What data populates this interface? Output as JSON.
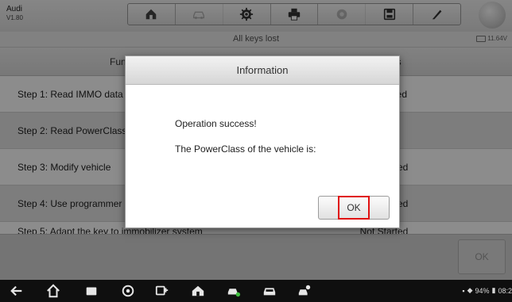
{
  "app": {
    "make": "Audi",
    "version": "V1.80"
  },
  "toolbar": {
    "buttons": [
      {
        "icon": "home-icon",
        "enabled": true
      },
      {
        "icon": "vehicle-swap-icon",
        "enabled": false
      },
      {
        "icon": "settings-icon",
        "enabled": true
      },
      {
        "icon": "print-icon",
        "enabled": true
      },
      {
        "icon": "help-icon",
        "enabled": false
      },
      {
        "icon": "save-icon",
        "enabled": true
      },
      {
        "icon": "data-logging-icon",
        "enabled": true
      }
    ]
  },
  "subtitle": "All keys lost",
  "voltage": "11.64V",
  "table": {
    "headers": [
      "Function",
      "Process"
    ],
    "rows": [
      {
        "function": "Step 1: Read IMMO data",
        "status": "Completed"
      },
      {
        "function": "Step 2: Read PowerClass",
        "status": ""
      },
      {
        "function": "Step 3: Modify vehicle",
        "status": "Not Started"
      },
      {
        "function": "Step 4: Use programmer",
        "status": "Not Started"
      },
      {
        "function": "Step 5: Adapt the key to immobilizer system",
        "status": "Not Started"
      }
    ]
  },
  "footer": {
    "ok_label": "OK"
  },
  "dialog": {
    "title": "Information",
    "line1": "Operation success!",
    "line2": "The PowerClass of the vehicle is:",
    "ok_label": "OK"
  },
  "navbar": {
    "icons": [
      "back-icon",
      "home-icon",
      "recent-apps-icon",
      "browser-icon",
      "vci-icon",
      "maxi-home-icon",
      "vehicle-diagnostics-icon",
      "car-icon",
      "remote-expert-icon"
    ],
    "battery": "94%",
    "time": "08:2"
  }
}
